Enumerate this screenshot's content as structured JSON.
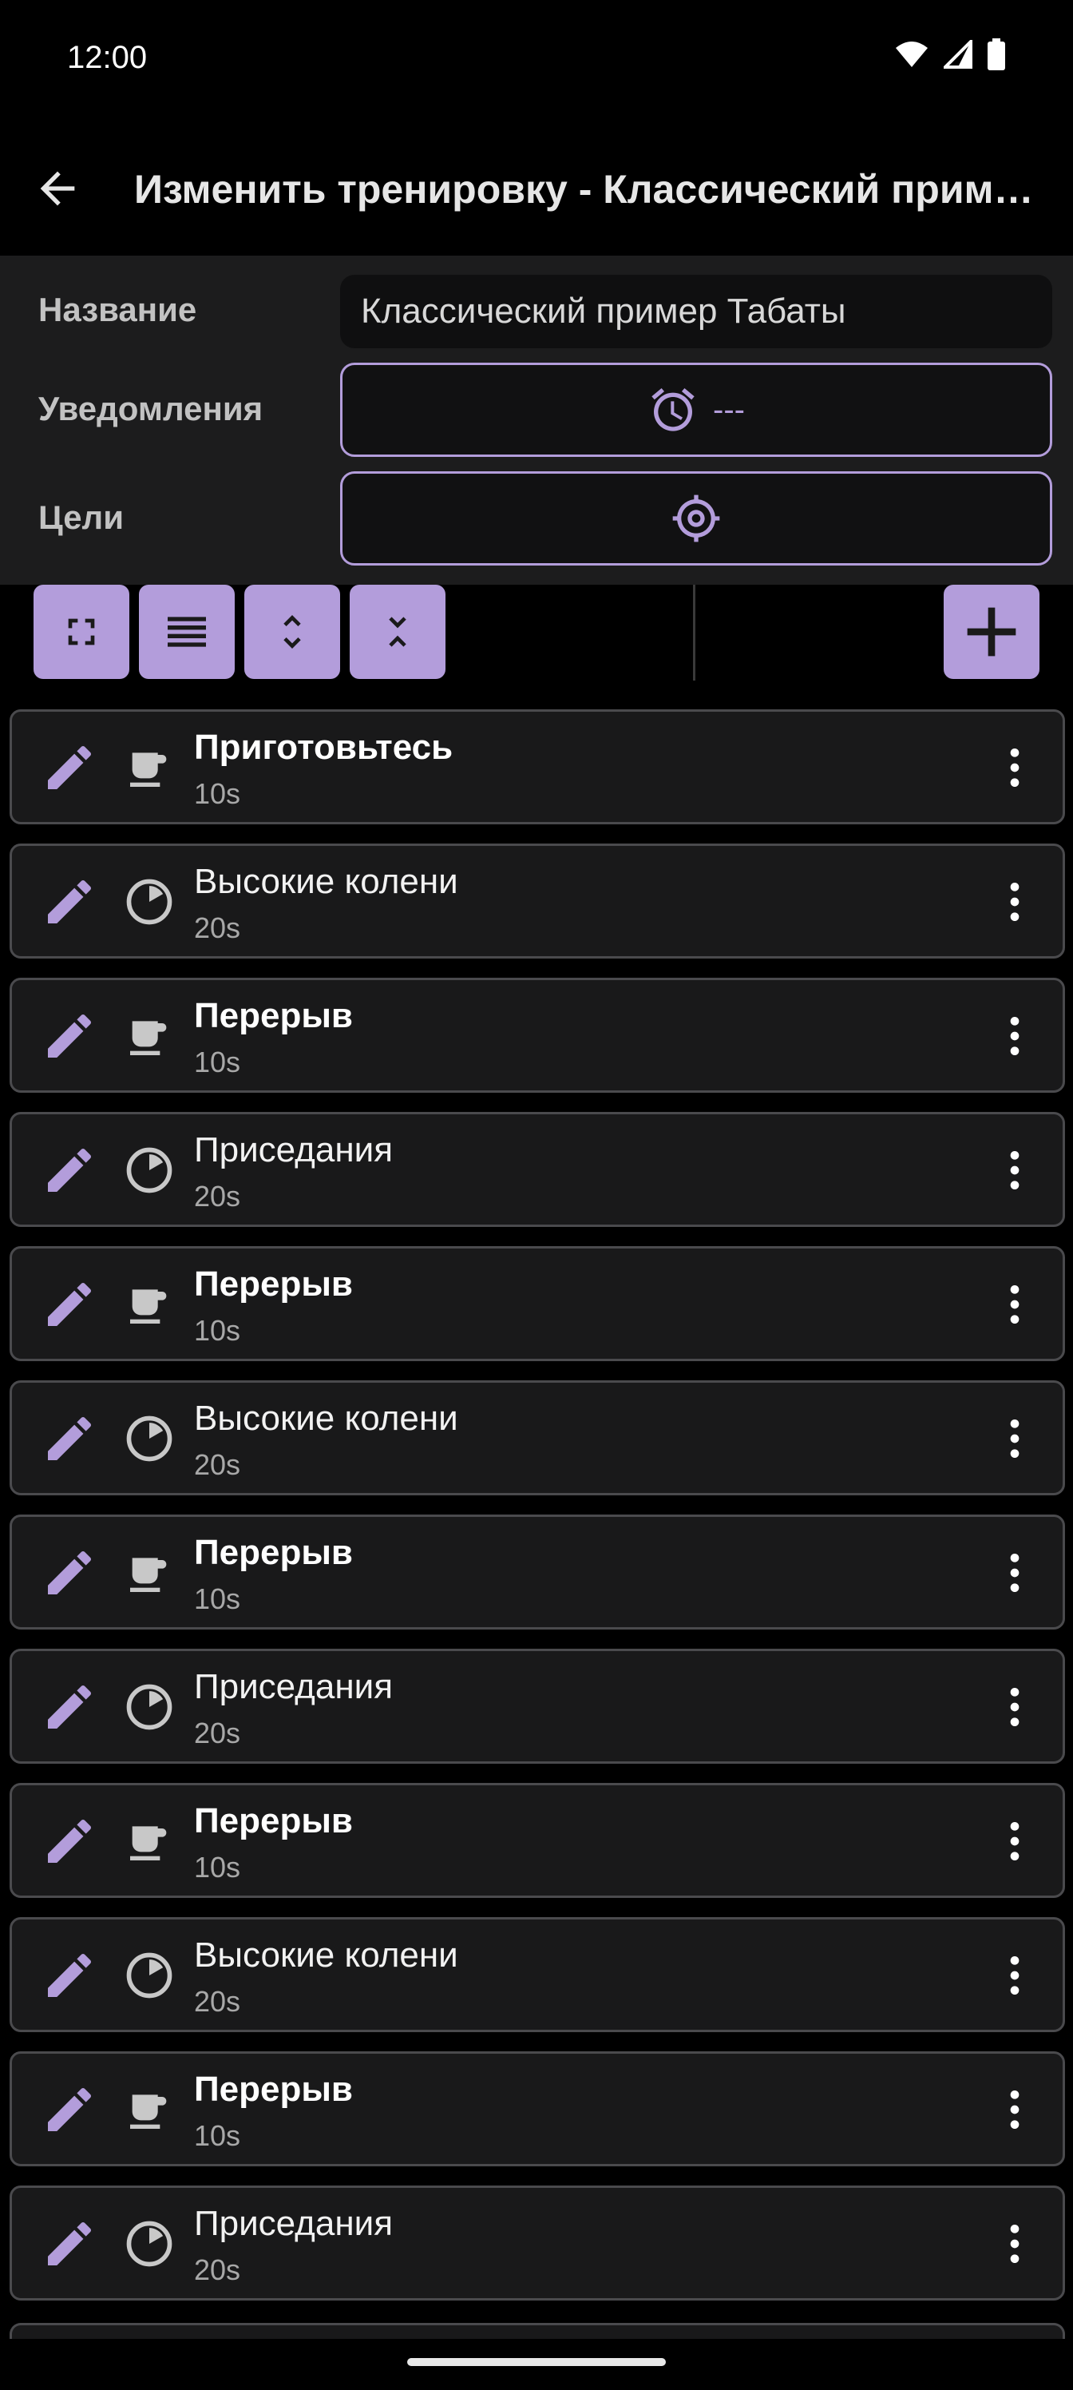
{
  "status_bar": {
    "time": "12:00"
  },
  "app_bar": {
    "title": "Изменить тренировку - Классический пример Табаты"
  },
  "form": {
    "name_label": "Название",
    "name_value": "Классический пример Табаты",
    "notifications_label": "Уведомления",
    "notifications_value": "---",
    "goals_label": "Цели"
  },
  "toolbar": {
    "icons": [
      "fullscreen-icon",
      "reorder-icon",
      "expand-icon",
      "collapse-icon",
      "add-icon"
    ]
  },
  "colors": {
    "accent": "#b39ddb",
    "background": "#000000",
    "panel": "#1c1c1d"
  },
  "items": [
    {
      "title": "Приготовьтесь",
      "duration": "10s",
      "type": "rest"
    },
    {
      "title": "Высокие колени",
      "duration": "20s",
      "type": "exercise"
    },
    {
      "title": "Перерыв",
      "duration": "10s",
      "type": "rest"
    },
    {
      "title": "Приседания",
      "duration": "20s",
      "type": "exercise"
    },
    {
      "title": "Перерыв",
      "duration": "10s",
      "type": "rest"
    },
    {
      "title": "Высокие колени",
      "duration": "20s",
      "type": "exercise"
    },
    {
      "title": "Перерыв",
      "duration": "10s",
      "type": "rest"
    },
    {
      "title": "Приседания",
      "duration": "20s",
      "type": "exercise"
    },
    {
      "title": "Перерыв",
      "duration": "10s",
      "type": "rest"
    },
    {
      "title": "Высокие колени",
      "duration": "20s",
      "type": "exercise"
    },
    {
      "title": "Перерыв",
      "duration": "10s",
      "type": "rest"
    },
    {
      "title": "Приседания",
      "duration": "20s",
      "type": "exercise"
    }
  ]
}
